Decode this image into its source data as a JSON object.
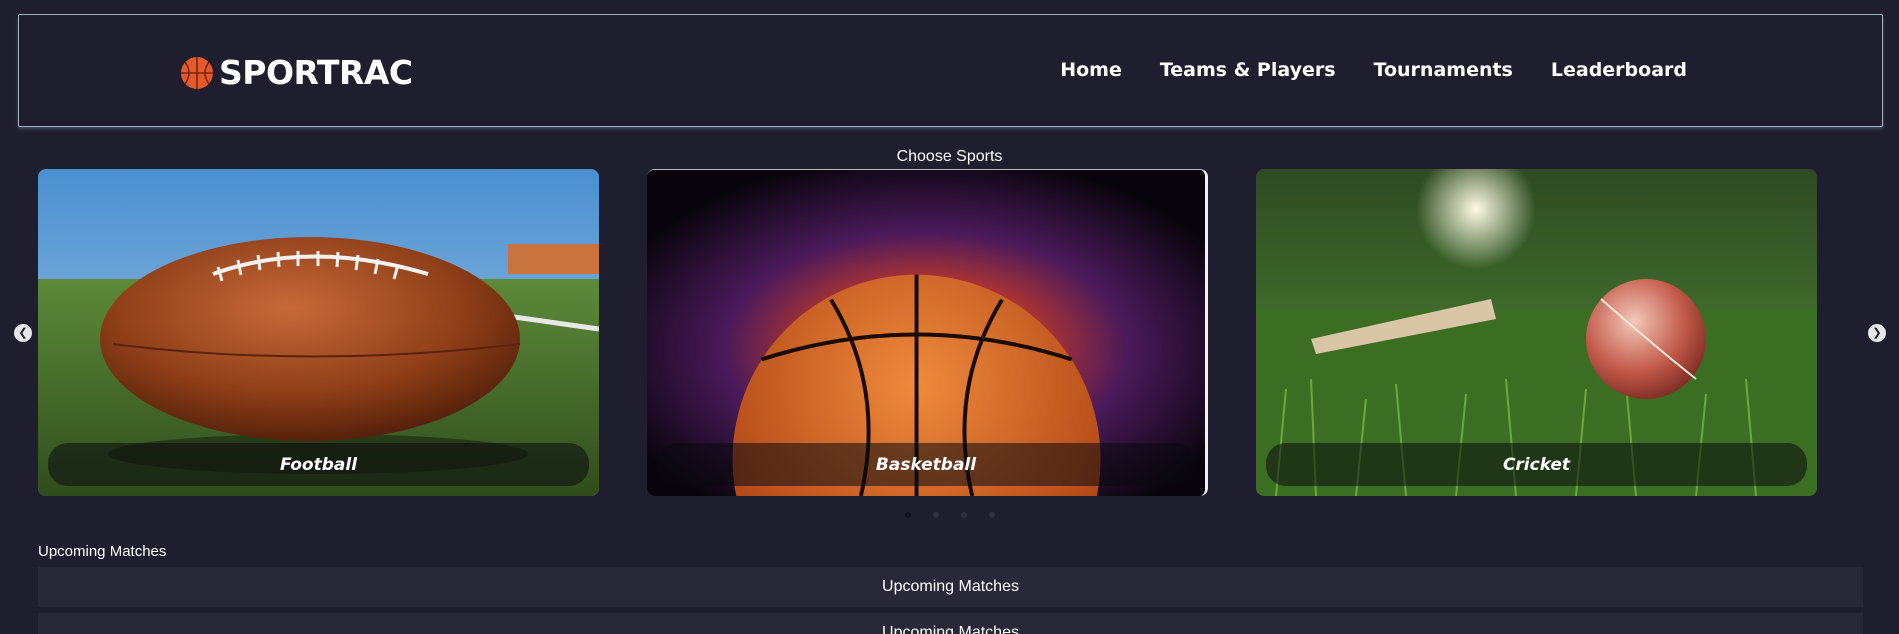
{
  "brand": {
    "name": "SPORTRAC",
    "logo_icon": "basketball-icon"
  },
  "nav": {
    "items": [
      "Home",
      "Teams & Players",
      "Tournaments",
      "Leaderboard"
    ]
  },
  "carousel": {
    "title": "Choose Sports",
    "cards": [
      {
        "label": "Football",
        "icon": "football-image"
      },
      {
        "label": "Basketball",
        "icon": "basketball-image"
      },
      {
        "label": "Cricket",
        "icon": "cricket-image"
      }
    ],
    "indicator_count": 4,
    "active_indicator": 1
  },
  "upcoming": {
    "title": "Upcoming Matches",
    "rows": [
      "Upcoming Matches",
      "Upcoming Matches"
    ]
  }
}
